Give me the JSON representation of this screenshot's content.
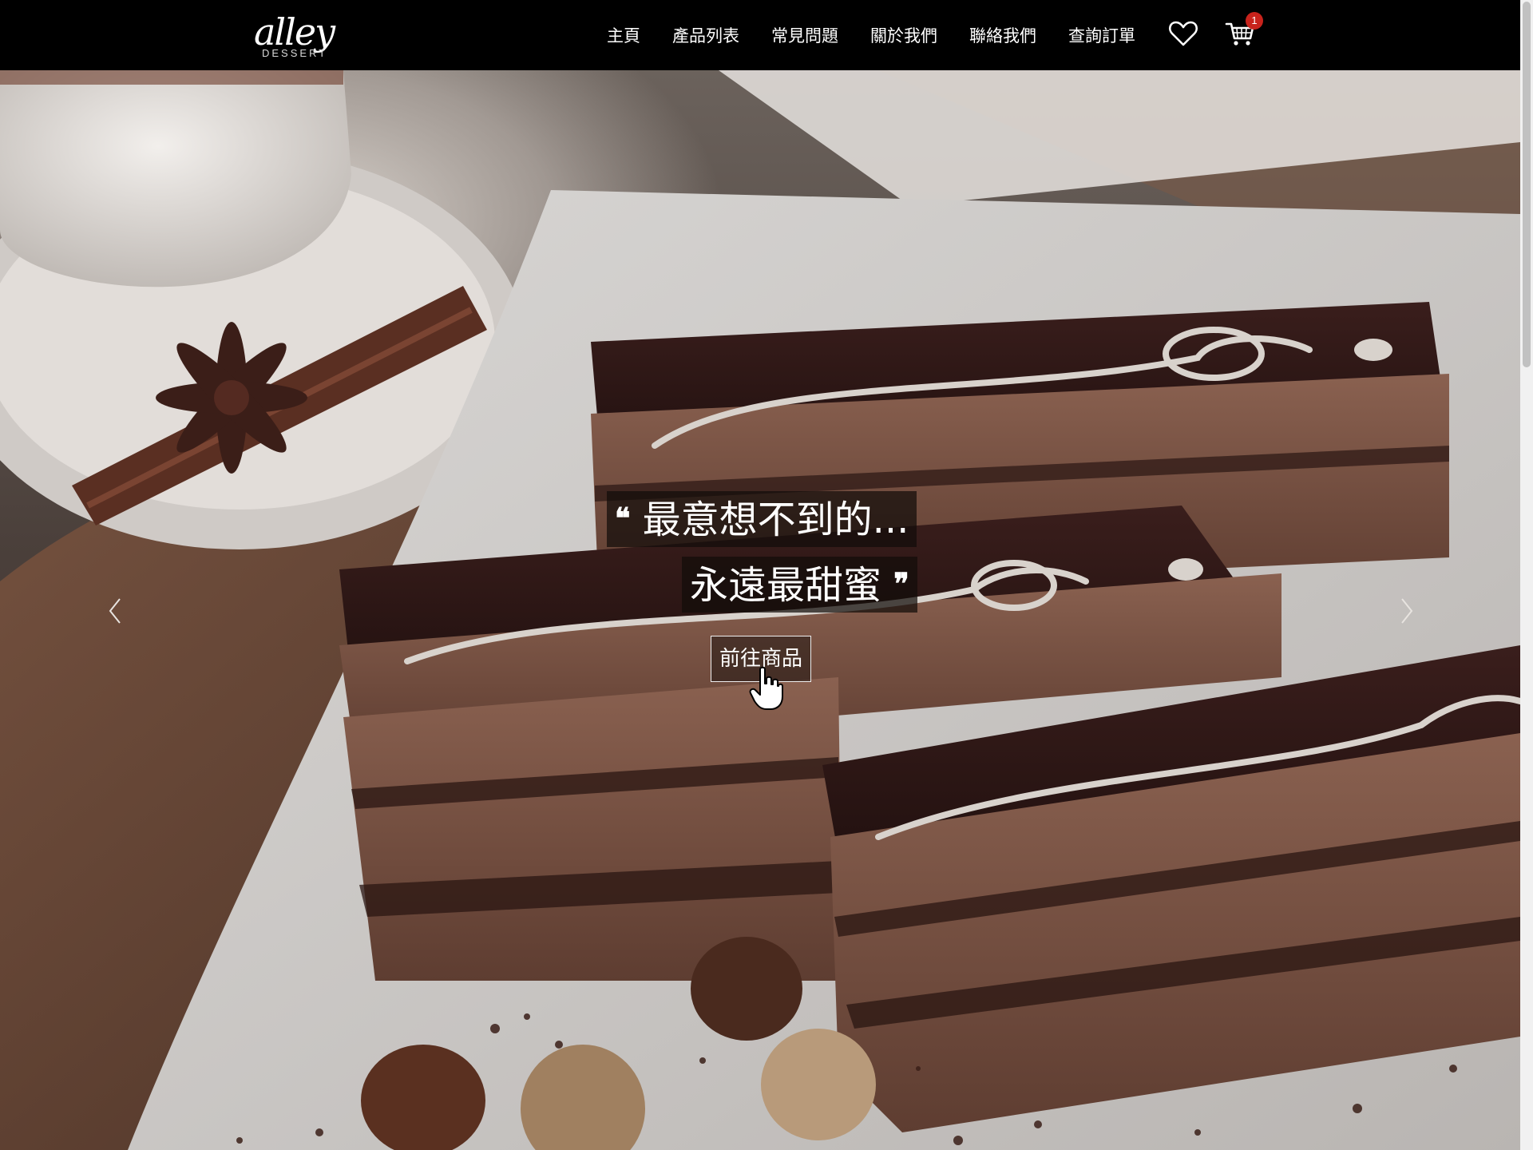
{
  "brand": {
    "logo_script": "alley",
    "logo_sub": "DESSERT"
  },
  "nav": {
    "items": [
      "主頁",
      "產品列表",
      "常見問題",
      "關於我們",
      "聯絡我們",
      "查詢訂單"
    ],
    "wishlist_icon": "heart-icon",
    "cart_icon": "cart-icon",
    "cart_count": "1"
  },
  "hero": {
    "caption_line1": "最意想不到的...",
    "caption_line2": "永遠最甜蜜",
    "quote_open": "❝",
    "quote_close": "❞",
    "cta_label": "前往商品",
    "prev_icon": "chevron-left-icon",
    "next_icon": "chevron-right-icon"
  },
  "colors": {
    "navbar": "#000000",
    "badge": "#c8231c",
    "chocolate": "#2b1513",
    "sponge": "#7a5446"
  }
}
